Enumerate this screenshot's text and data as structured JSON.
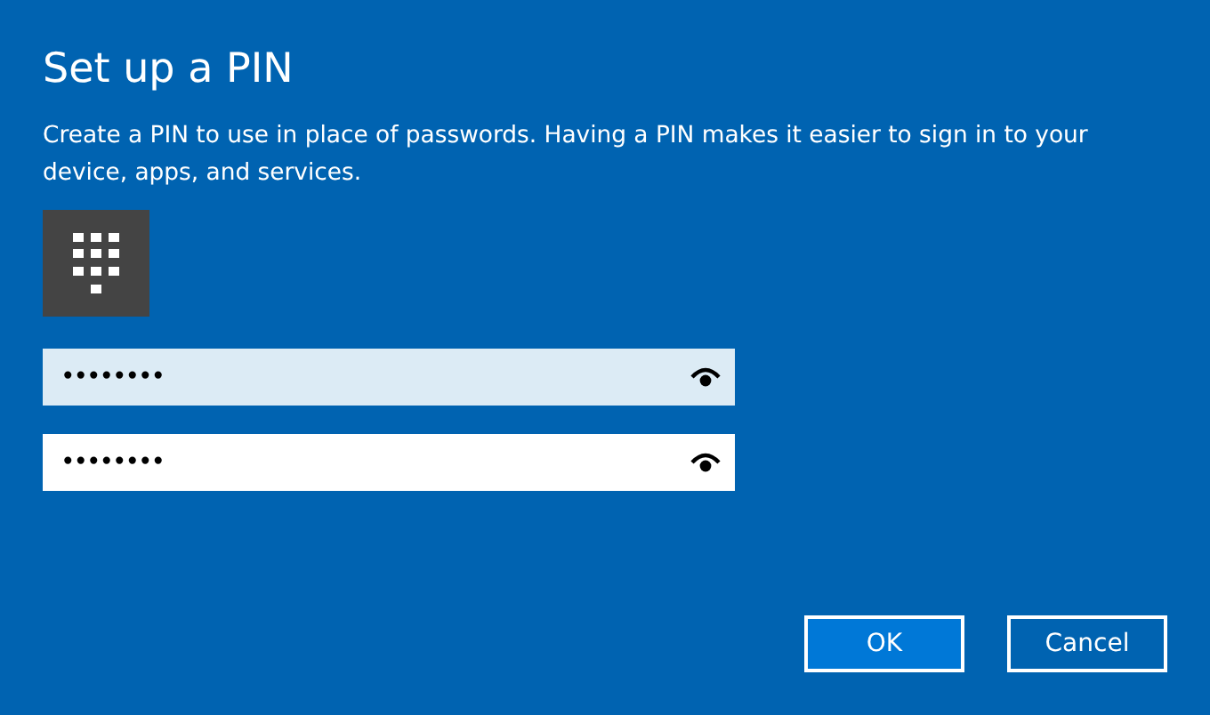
{
  "title": "Set up a PIN",
  "description": "Create a PIN to use in place of passwords. Having a PIN makes it easier to sign in to your device, apps, and services.",
  "fields": [
    {
      "value": "••••••••",
      "focused": true
    },
    {
      "value": "••••••••",
      "focused": false
    }
  ],
  "buttons": [
    {
      "label": "OK",
      "default": true
    },
    {
      "label": "Cancel",
      "default": false
    }
  ]
}
